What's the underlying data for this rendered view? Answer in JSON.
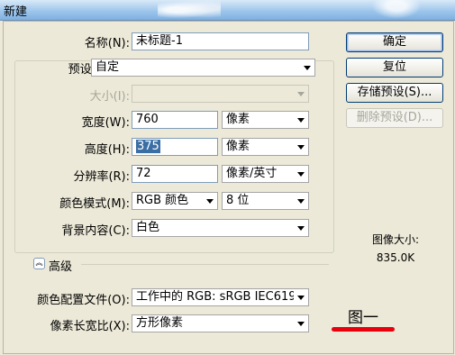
{
  "window": {
    "title": "新建"
  },
  "form": {
    "name_label": "名称(N):",
    "name_value": "未标题-1",
    "preset_label": "预设(P):",
    "preset_value": "自定",
    "size_label": "大小(I):",
    "size_value": "",
    "width_label": "宽度(W):",
    "width_value": "760",
    "width_unit": "像素",
    "height_label": "高度(H):",
    "height_value": "375",
    "height_unit": "像素",
    "resolution_label": "分辨率(R):",
    "resolution_value": "72",
    "resolution_unit": "像素/英寸",
    "color_mode_label": "颜色模式(M):",
    "color_mode_value": "RGB 颜色",
    "bit_depth_value": "8 位",
    "background_label": "背景内容(C):",
    "background_value": "白色",
    "advanced_label": "高级",
    "color_profile_label": "颜色配置文件(O):",
    "color_profile_value": "工作中的 RGB: sRGB IEC6196...",
    "pixel_aspect_label": "像素长宽比(X):",
    "pixel_aspect_value": "方形像素"
  },
  "buttons": {
    "ok": "确定",
    "reset": "复位",
    "save_preset": "存储预设(S)...",
    "delete_preset": "删除预设(D)..."
  },
  "info": {
    "image_size_label": "图像大小:",
    "image_size_value": "835.0K"
  },
  "annotation": {
    "caption": "图一",
    "underline_color": "#e8000d"
  },
  "icons": {
    "dropdown": "chevron-down-icon",
    "advanced_toggle": "double-chevron-up-icon"
  }
}
